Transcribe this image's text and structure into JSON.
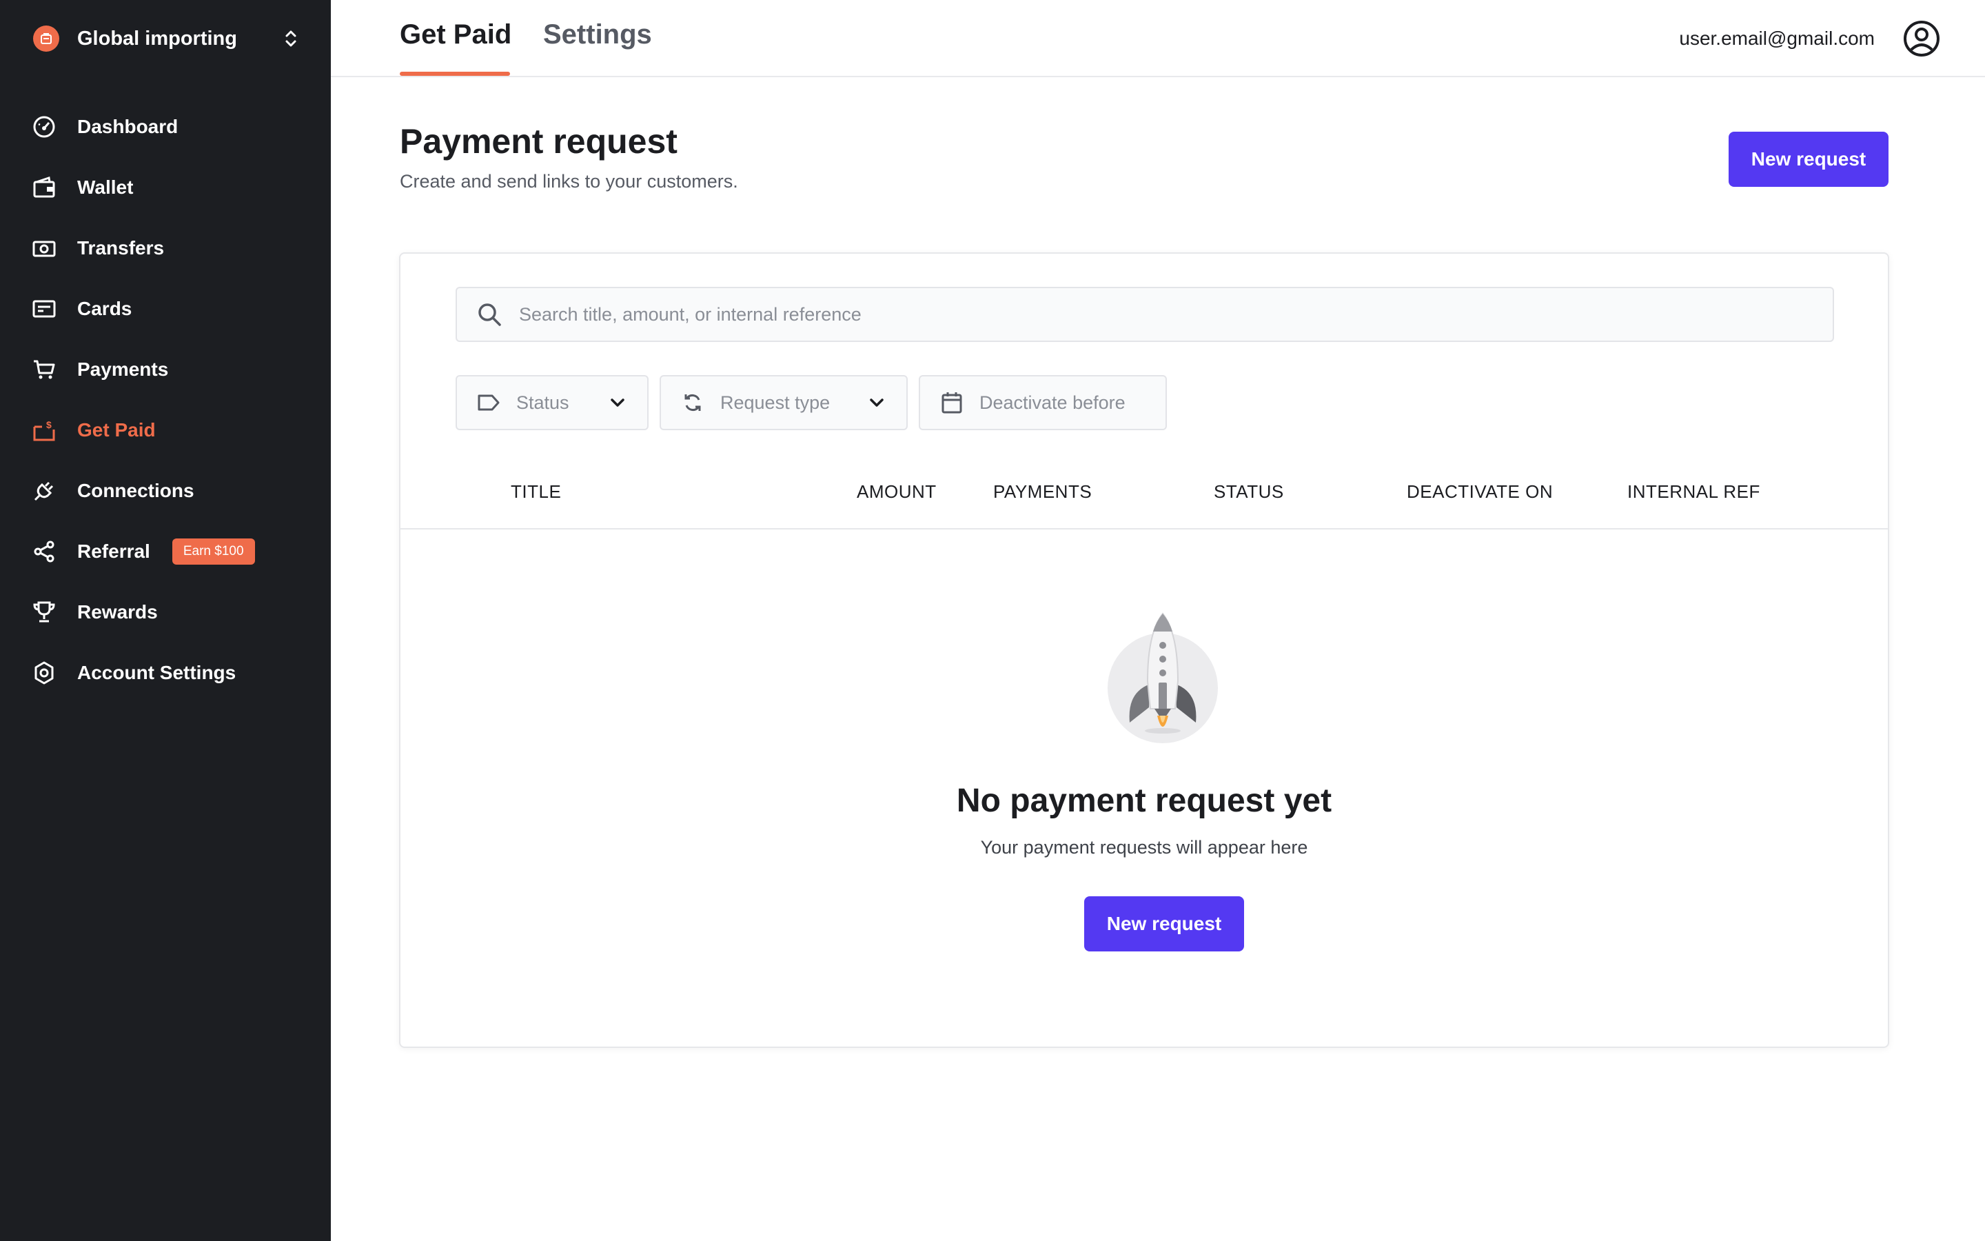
{
  "sidebar": {
    "org_name": "Global importing",
    "items": [
      {
        "label": "Dashboard",
        "icon": "dashboard-icon"
      },
      {
        "label": "Wallet",
        "icon": "wallet-icon"
      },
      {
        "label": "Transfers",
        "icon": "transfers-icon"
      },
      {
        "label": "Cards",
        "icon": "card-icon"
      },
      {
        "label": "Payments",
        "icon": "cart-icon"
      },
      {
        "label": "Get Paid",
        "icon": "get-paid-icon",
        "active": true
      },
      {
        "label": "Connections",
        "icon": "plug-icon"
      },
      {
        "label": "Referral",
        "icon": "share-icon",
        "badge": "Earn $100"
      },
      {
        "label": "Rewards",
        "icon": "trophy-icon"
      },
      {
        "label": "Account Settings",
        "icon": "gear-icon"
      }
    ]
  },
  "topbar": {
    "tabs": [
      {
        "label": "Get Paid",
        "active": true
      },
      {
        "label": "Settings",
        "active": false
      }
    ],
    "user_email": "user.email@gmail.com"
  },
  "page": {
    "title": "Payment request",
    "subtitle": "Create and send links to your customers.",
    "new_request_label": "New request"
  },
  "filters": {
    "search_placeholder": "Search title, amount, or internal reference",
    "status": "Status",
    "request_type": "Request type",
    "deactivate_before": "Deactivate before"
  },
  "table": {
    "columns": [
      "TITLE",
      "AMOUNT",
      "PAYMENTS",
      "STATUS",
      "DEACTIVATE ON",
      "INTERNAL REF"
    ]
  },
  "empty_state": {
    "title": "No payment request yet",
    "subtitle": "Your payment requests will appear here",
    "button_label": "New request"
  },
  "colors": {
    "accent": "#ef6c4a",
    "primary_button": "#5439f2",
    "sidebar_bg": "#1c1e22"
  }
}
